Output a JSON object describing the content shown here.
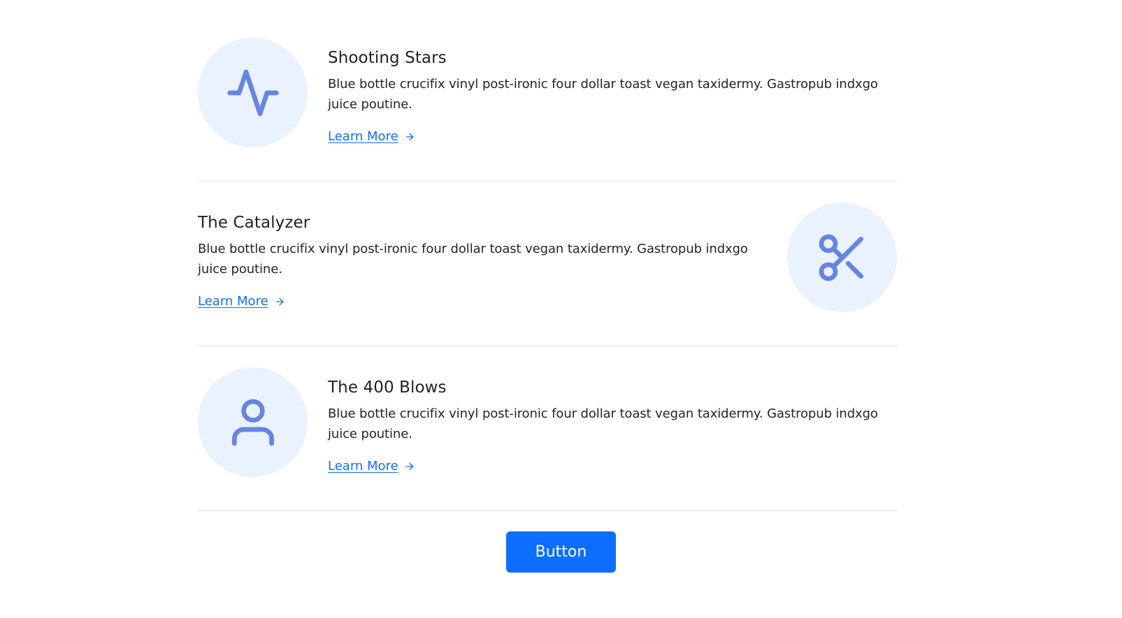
{
  "features": [
    {
      "title": "Shooting Stars",
      "description": "Blue bottle crucifix vinyl post-ironic four dollar toast vegan taxidermy. Gastropub indxgo juice poutine.",
      "link_label": "Learn More",
      "icon": "activity-pulse-icon"
    },
    {
      "title": "The Catalyzer",
      "description": "Blue bottle crucifix vinyl post-ironic four dollar toast vegan taxidermy. Gastropub indxgo juice poutine.",
      "link_label": "Learn More",
      "icon": "scissors-icon"
    },
    {
      "title": "The 400 Blows",
      "description": "Blue bottle crucifix vinyl post-ironic four dollar toast vegan taxidermy. Gastropub indxgo juice poutine.",
      "link_label": "Learn More",
      "icon": "user-icon"
    }
  ],
  "button_label": "Button",
  "colors": {
    "accent": "#0d6efd",
    "icon_stroke": "#6684e0",
    "icon_bg": "#eaf2fe",
    "divider": "#dee2e6"
  }
}
